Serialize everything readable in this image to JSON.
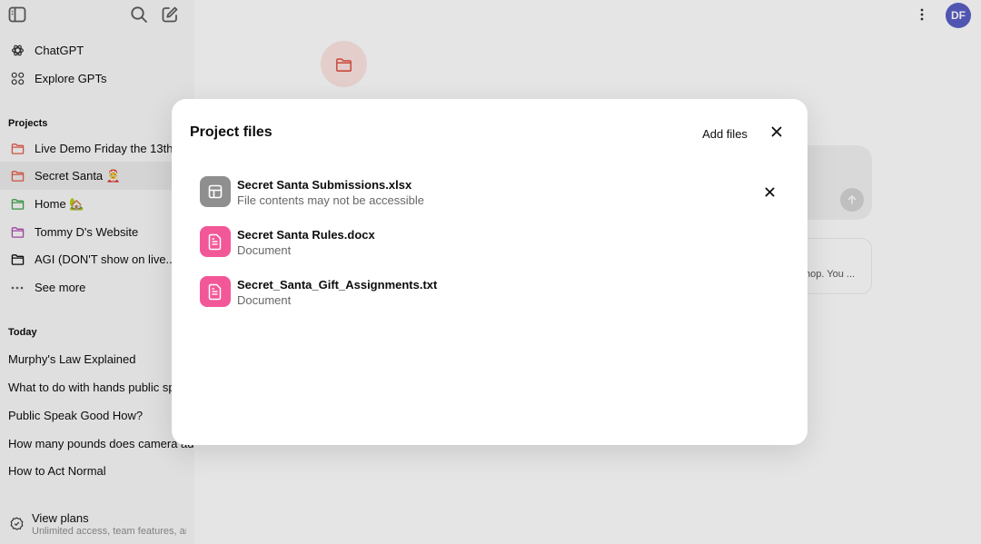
{
  "sidebar": {
    "top_nav": [
      {
        "label": "ChatGPT",
        "icon": "openai-logo-icon"
      },
      {
        "label": "Explore GPTs",
        "icon": "grid-icon"
      }
    ],
    "projects_title": "Projects",
    "projects": [
      {
        "label": "Live Demo Friday the 13th",
        "color": "#e25c4b"
      },
      {
        "label": "Secret Santa 🤶",
        "color": "#e25c4b"
      },
      {
        "label": "Home 🏡",
        "color": "#3fa34d"
      },
      {
        "label": "Tommy D's Website",
        "color": "#b04fb0"
      },
      {
        "label": "AGI (DON'T show on live...",
        "color": "#0d0d0d"
      }
    ],
    "see_more": "See more",
    "today_title": "Today",
    "chats": [
      "Murphy's Law Explained",
      "What to do with hands public speaking",
      "Public Speak Good How?",
      "How many pounds does camera add",
      "How to Act Normal"
    ],
    "plans": {
      "title": "View plans",
      "subtitle": "Unlimited access, team features, and more"
    }
  },
  "header": {
    "avatar_initials": "DF",
    "avatar_color": "#5b5fc7"
  },
  "background": {
    "snippet": "hop. You ..."
  },
  "modal": {
    "title": "Project files",
    "add_files_label": "Add files",
    "files": [
      {
        "name": "Secret Santa Submissions.xlsx",
        "subtitle": "File contents may not be accessible",
        "icon": "spreadsheet-icon",
        "icon_color": "#8f8f8f"
      },
      {
        "name": "Secret Santa Rules.docx",
        "subtitle": "Document",
        "icon": "document-icon",
        "icon_color": "#f25797"
      },
      {
        "name": "Secret_Santa_Gift_Assignments.txt",
        "subtitle": "Document",
        "icon": "document-icon",
        "icon_color": "#f25797"
      }
    ]
  }
}
